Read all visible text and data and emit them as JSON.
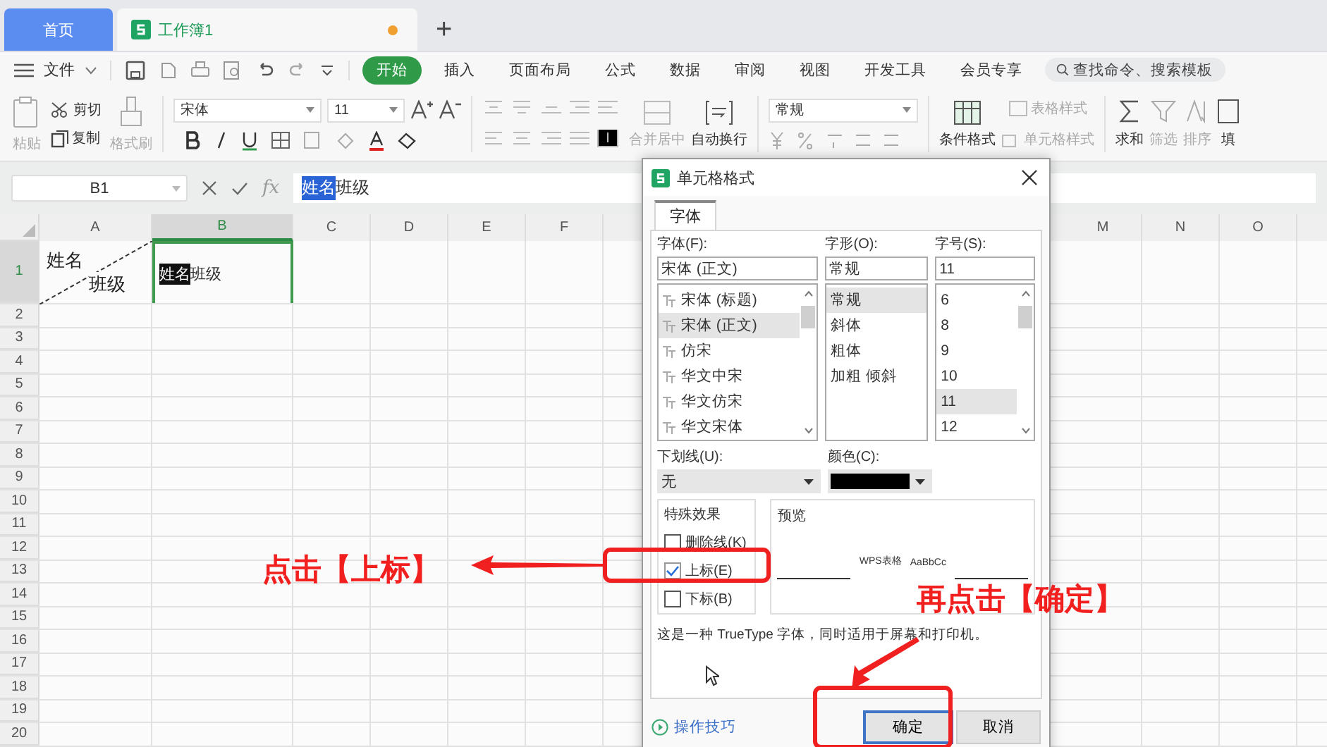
{
  "tabs": [
    {
      "label": "首页",
      "selected": false,
      "kind": "home"
    },
    {
      "label": "工作簿1",
      "selected": true,
      "kind": "doc"
    }
  ],
  "new_tab": "+",
  "menu": {
    "file": "文件",
    "tabs": [
      {
        "label": "开始",
        "selected": true
      },
      {
        "label": "插入",
        "selected": false
      },
      {
        "label": "页面布局",
        "selected": false
      },
      {
        "label": "公式",
        "selected": false
      },
      {
        "label": "数据",
        "selected": false
      },
      {
        "label": "审阅",
        "selected": false
      },
      {
        "label": "视图",
        "selected": false
      },
      {
        "label": "开发工具",
        "selected": false
      },
      {
        "label": "会员专享",
        "selected": false
      }
    ],
    "search": {
      "placeholder": "查找命令、搜索模板"
    }
  },
  "ribbon": {
    "paste": "粘贴",
    "cut": "剪切",
    "copy": "复制",
    "format_painter": "格式刷",
    "font_name": "宋体",
    "font_size": "11",
    "merge": "合并居中",
    "wrap": "自动换行",
    "number_format": "常规",
    "conditional": "条件格式",
    "table_style": "表格样式",
    "cell_style": "单元格样式",
    "sum": "求和",
    "filter": "筛选",
    "sort": "排序",
    "fill": "填"
  },
  "formula_bar": {
    "cell_ref": "B1",
    "fx": "fx",
    "selected_text": "姓名",
    "rest": "班级"
  },
  "sheet": {
    "columns": [
      {
        "label": "A",
        "selected": false
      },
      {
        "label": "B",
        "selected": true
      },
      {
        "label": "C",
        "selected": false
      },
      {
        "label": "D",
        "selected": false
      },
      {
        "label": "E",
        "selected": false
      },
      {
        "label": "F",
        "selected": false
      },
      {
        "label": "M",
        "selected": false
      },
      {
        "label": "N",
        "selected": false
      },
      {
        "label": "O",
        "selected": false
      }
    ],
    "rows": [
      {
        "label": "1",
        "selected": true
      },
      {
        "label": "2",
        "selected": false
      },
      {
        "label": "3",
        "selected": false
      },
      {
        "label": "4",
        "selected": false
      },
      {
        "label": "5",
        "selected": false
      },
      {
        "label": "6",
        "selected": false
      },
      {
        "label": "7",
        "selected": false
      },
      {
        "label": "8",
        "selected": false
      },
      {
        "label": "9",
        "selected": false
      },
      {
        "label": "10",
        "selected": false
      },
      {
        "label": "11",
        "selected": false
      },
      {
        "label": "12",
        "selected": false
      },
      {
        "label": "13",
        "selected": false
      },
      {
        "label": "14",
        "selected": false
      },
      {
        "label": "15",
        "selected": false
      },
      {
        "label": "16",
        "selected": false
      },
      {
        "label": "17",
        "selected": false
      },
      {
        "label": "18",
        "selected": false
      },
      {
        "label": "19",
        "selected": false
      },
      {
        "label": "20",
        "selected": false
      }
    ],
    "cell_a1": {
      "top": "姓名",
      "bottom": "班级",
      "diagonal": true
    },
    "cell_b1": {
      "selected_text": "姓名",
      "rest": "班级",
      "selected": true
    }
  },
  "dialog": {
    "title": "单元格格式",
    "tabs": [
      {
        "label": "字体",
        "selected": true
      }
    ],
    "font": {
      "label": "字体(F):",
      "value": "宋体 (正文)",
      "items": [
        {
          "label": "宋体 (标题)",
          "selected": false
        },
        {
          "label": "宋体 (正文)",
          "selected": true
        },
        {
          "label": "仿宋",
          "selected": false
        },
        {
          "label": "华文中宋",
          "selected": false
        },
        {
          "label": "华文仿宋",
          "selected": false
        },
        {
          "label": "华文宋体",
          "selected": false
        }
      ]
    },
    "style": {
      "label": "字形(O):",
      "value": "常规",
      "items": [
        {
          "label": "常规",
          "selected": true
        },
        {
          "label": "斜体",
          "selected": false
        },
        {
          "label": "粗体",
          "selected": false
        },
        {
          "label": "加粗 倾斜",
          "selected": false
        }
      ]
    },
    "size": {
      "label": "字号(S):",
      "value": "11",
      "items": [
        {
          "label": "6",
          "selected": false
        },
        {
          "label": "8",
          "selected": false
        },
        {
          "label": "9",
          "selected": false
        },
        {
          "label": "10",
          "selected": false
        },
        {
          "label": "11",
          "selected": true
        },
        {
          "label": "12",
          "selected": false
        }
      ]
    },
    "underline": {
      "label": "下划线(U):",
      "value": "无"
    },
    "color": {
      "label": "颜色(C):",
      "color": "#000000"
    },
    "effects": {
      "title": "特殊效果",
      "items": [
        {
          "label": "删除线(K)",
          "checked": false
        },
        {
          "label": "上标(E)",
          "checked": true
        },
        {
          "label": "下标(B)",
          "checked": false
        }
      ]
    },
    "preview": {
      "title": "预览",
      "sample": "WPS表格",
      "sample_2": "AaBbCc"
    },
    "note": "这是一种 TrueType 字体，同时适用于屏幕和打印机。",
    "tips": "操作技巧",
    "buttons": [
      {
        "label": "确定",
        "kind": "primary"
      },
      {
        "label": "取消",
        "kind": "normal"
      }
    ]
  },
  "annotations": [
    {
      "text": "点击【上标】"
    },
    {
      "text": "再点击【确定】"
    }
  ]
}
